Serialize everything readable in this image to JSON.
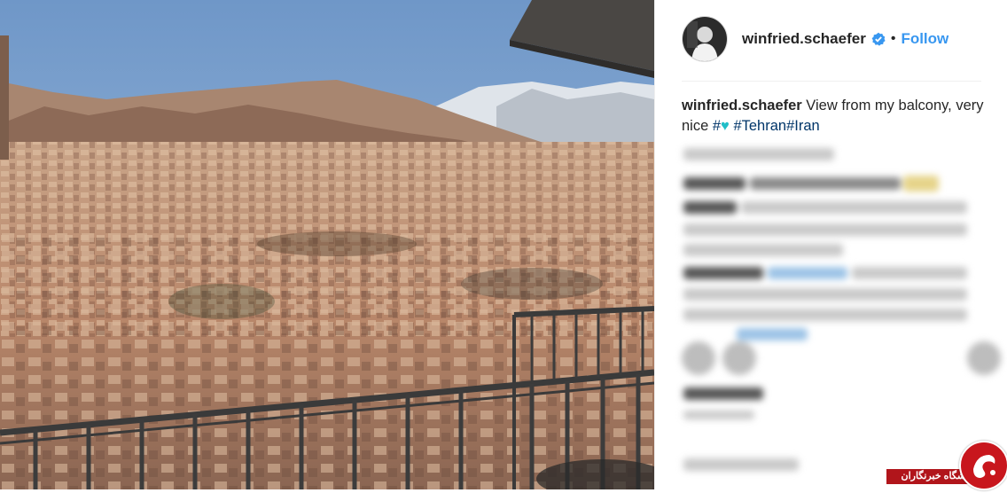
{
  "post": {
    "username": "winfried.schaefer",
    "separator": "•",
    "follow_label": "Follow",
    "caption": {
      "username": "winfried.schaefer",
      "text": " View from my balcony, very nice ",
      "hash_sign": "#",
      "heart": "♥",
      "tags": [
        "#Tehran",
        "#Iran"
      ]
    }
  },
  "icons": {
    "verified": "verified-badge-icon",
    "heart": "heart-emoji-icon"
  },
  "colors": {
    "follow": "#3897f0",
    "hashtag": "#003569",
    "heart": "#20bec8",
    "watermark": "#b1151b"
  },
  "watermark": {
    "label": "باشگاه خبرنگاران"
  }
}
